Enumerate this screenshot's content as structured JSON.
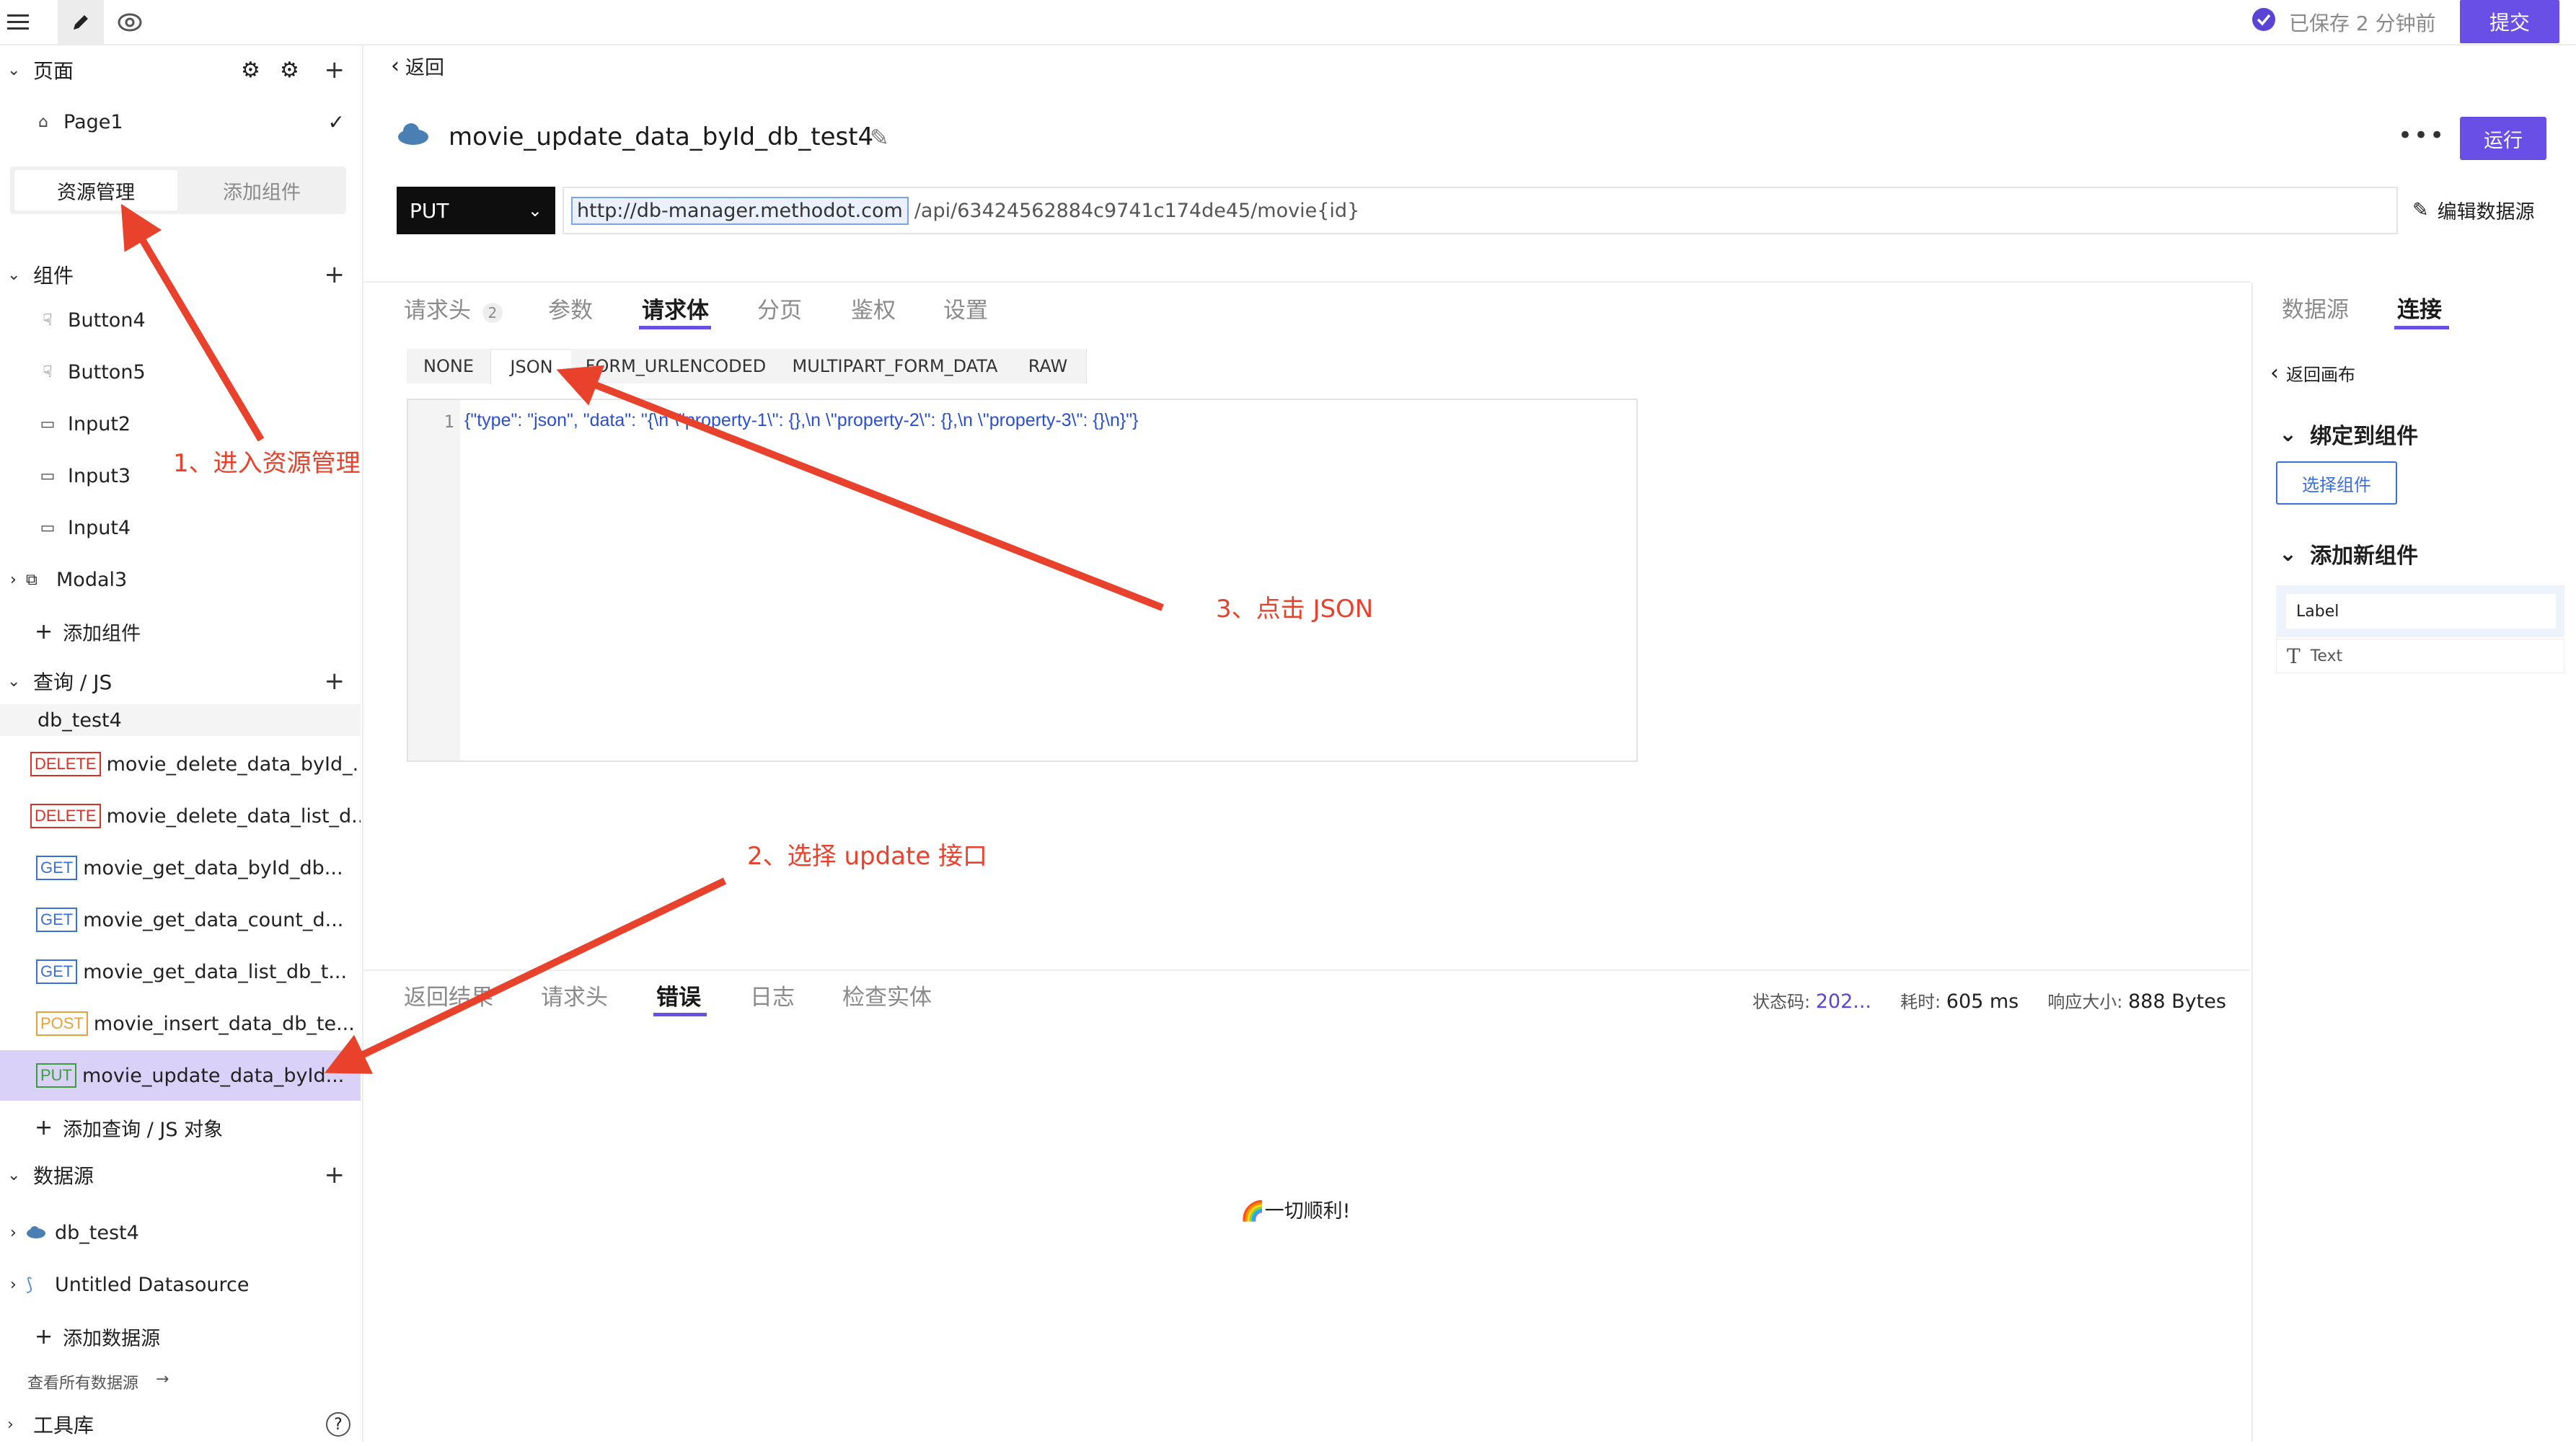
{
  "topbar": {
    "menu_icon": "hamburger-icon",
    "edit_icon": "pencil-icon",
    "preview_icon": "eye-icon",
    "saved_text": "已保存 2 分钟前",
    "submit_label": "提交"
  },
  "sidebar": {
    "pages_title": "页面",
    "page_item": "Page1",
    "tab_resources": "资源管理",
    "tab_add_component": "添加组件",
    "components_title": "组件",
    "components": [
      "Button4",
      "Button5",
      "Input2",
      "Input3",
      "Input4",
      "Modal3"
    ],
    "add_component": "添加组件",
    "queries_title": "查询 / JS",
    "query_group": "db_test4",
    "queries": [
      {
        "method": "DELETE",
        "name": "movie_delete_data_byId_..."
      },
      {
        "method": "DELETE",
        "name": "movie_delete_data_list_d..."
      },
      {
        "method": "GET",
        "name": "movie_get_data_byId_db..."
      },
      {
        "method": "GET",
        "name": "movie_get_data_count_d..."
      },
      {
        "method": "GET",
        "name": "movie_get_data_list_db_t..."
      },
      {
        "method": "POST",
        "name": "movie_insert_data_db_te..."
      },
      {
        "method": "PUT",
        "name": "movie_update_data_byId..."
      }
    ],
    "add_query": "添加查询 / JS 对象",
    "datasources_title": "数据源",
    "datasources": [
      "db_test4",
      "Untitled Datasource"
    ],
    "add_datasource": "添加数据源",
    "view_all_datasources": "查看所有数据源",
    "toolbox_title": "工具库"
  },
  "main": {
    "back_label": "返回",
    "query_title": "movie_update_data_byId_db_test4",
    "run_label": "运行",
    "method": "PUT",
    "url_base": "http://db-manager.methodot.com",
    "url_path": "/api/63424562884c9741c174de45/movie{id}",
    "edit_datasource": "编辑数据源",
    "tabs": [
      "请求头",
      "参数",
      "请求体",
      "分页",
      "鉴权",
      "设置"
    ],
    "header_count": "2",
    "body_types": [
      "NONE",
      "JSON",
      "FORM_URLENCODED",
      "MULTIPART_FORM_DATA",
      "RAW"
    ],
    "line_number": "1",
    "code_line": "{\"type\": \"json\", \"data\": \"{\\n  \\\"property-1\\\": {},\\n  \\\"property-2\\\": {},\\n  \\\"property-3\\\": {}\\n}\"}",
    "response_tabs": [
      "返回结果",
      "请求头",
      "错误",
      "日志",
      "检查实体"
    ],
    "status_label": "状态码:",
    "status_value": "202...",
    "time_label": "耗时:",
    "time_value": "605 ms",
    "size_label": "响应大小:",
    "size_value": "888 Bytes",
    "success_message": "🌈一切顺利!"
  },
  "right_panel": {
    "tab_datasource": "数据源",
    "tab_connect": "连接",
    "back_canvas": "返回画布",
    "bind_title": "绑定到组件",
    "select_component": "选择组件",
    "add_new_title": "添加新组件",
    "widgets": [
      "Label",
      "Text"
    ]
  },
  "annotations": {
    "step1": "1、进入资源管理",
    "step2": "2、选择 update 接口",
    "step3": "3、点击 JSON"
  },
  "colors": {
    "accent": "#6a4fe6",
    "annotation": "#e8412c"
  }
}
